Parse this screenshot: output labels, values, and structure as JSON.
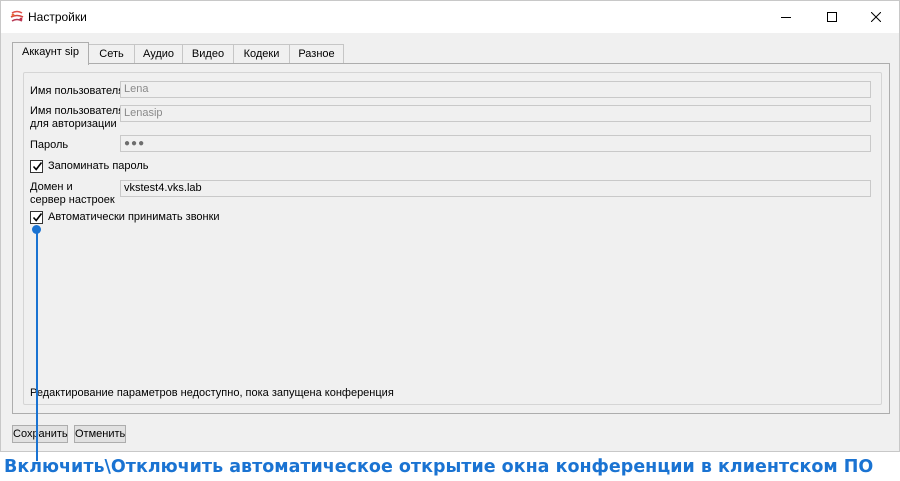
{
  "window": {
    "title": "Настройки",
    "accent_color": "#b0364a"
  },
  "tabs": [
    {
      "label": "Аккаунт sip",
      "active": true
    },
    {
      "label": "Сеть",
      "active": false
    },
    {
      "label": "Аудио",
      "active": false
    },
    {
      "label": "Видео",
      "active": false
    },
    {
      "label": "Кодеки",
      "active": false
    },
    {
      "label": "Разное",
      "active": false
    }
  ],
  "form": {
    "username_label": "Имя пользователя",
    "username_value": "Lena",
    "auth_username_label_1": "Имя пользователя",
    "auth_username_label_2": "для авторизации",
    "auth_username_value": "Lenasip",
    "password_label": "Пароль",
    "password_value": "●●●",
    "remember_password_label": "Запоминать пароль",
    "remember_password_checked": true,
    "domain_label_1": "Домен и",
    "domain_label_2": "сервер настроек",
    "domain_value": "vkstest4.vks.lab",
    "auto_answer_label": "Автоматически принимать звонки",
    "auto_answer_checked": true
  },
  "status_text": "Редактирование параметров недоступно, пока запущена конференция",
  "buttons": {
    "save": "Сохранить",
    "cancel": "Отменить"
  },
  "annotation": {
    "caption": "Включить\\Отключить автоматическое открытие окна конференции в клиентском ПО",
    "color": "#1a73d2"
  }
}
